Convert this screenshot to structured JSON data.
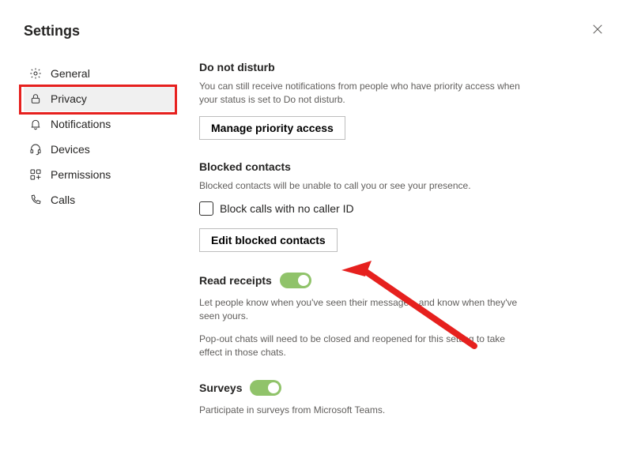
{
  "title": "Settings",
  "sidebar": {
    "items": [
      {
        "label": "General"
      },
      {
        "label": "Privacy"
      },
      {
        "label": "Notifications"
      },
      {
        "label": "Devices"
      },
      {
        "label": "Permissions"
      },
      {
        "label": "Calls"
      }
    ]
  },
  "dnd": {
    "heading": "Do not disturb",
    "subtext": "You can still receive notifications from people who have priority access when your status is set to Do not disturb.",
    "button": "Manage priority access"
  },
  "blocked": {
    "heading": "Blocked contacts",
    "subtext": "Blocked contacts will be unable to call you or see your presence.",
    "checkbox_label": "Block calls with no caller ID",
    "button": "Edit blocked contacts"
  },
  "read_receipts": {
    "heading": "Read receipts",
    "subtext1": "Let people know when you've seen their messages, and know when they've seen yours.",
    "subtext2": "Pop-out chats will need to be closed and reopened for this setting to take effect in those chats."
  },
  "surveys": {
    "heading": "Surveys",
    "subtext": "Participate in surveys from Microsoft Teams."
  }
}
